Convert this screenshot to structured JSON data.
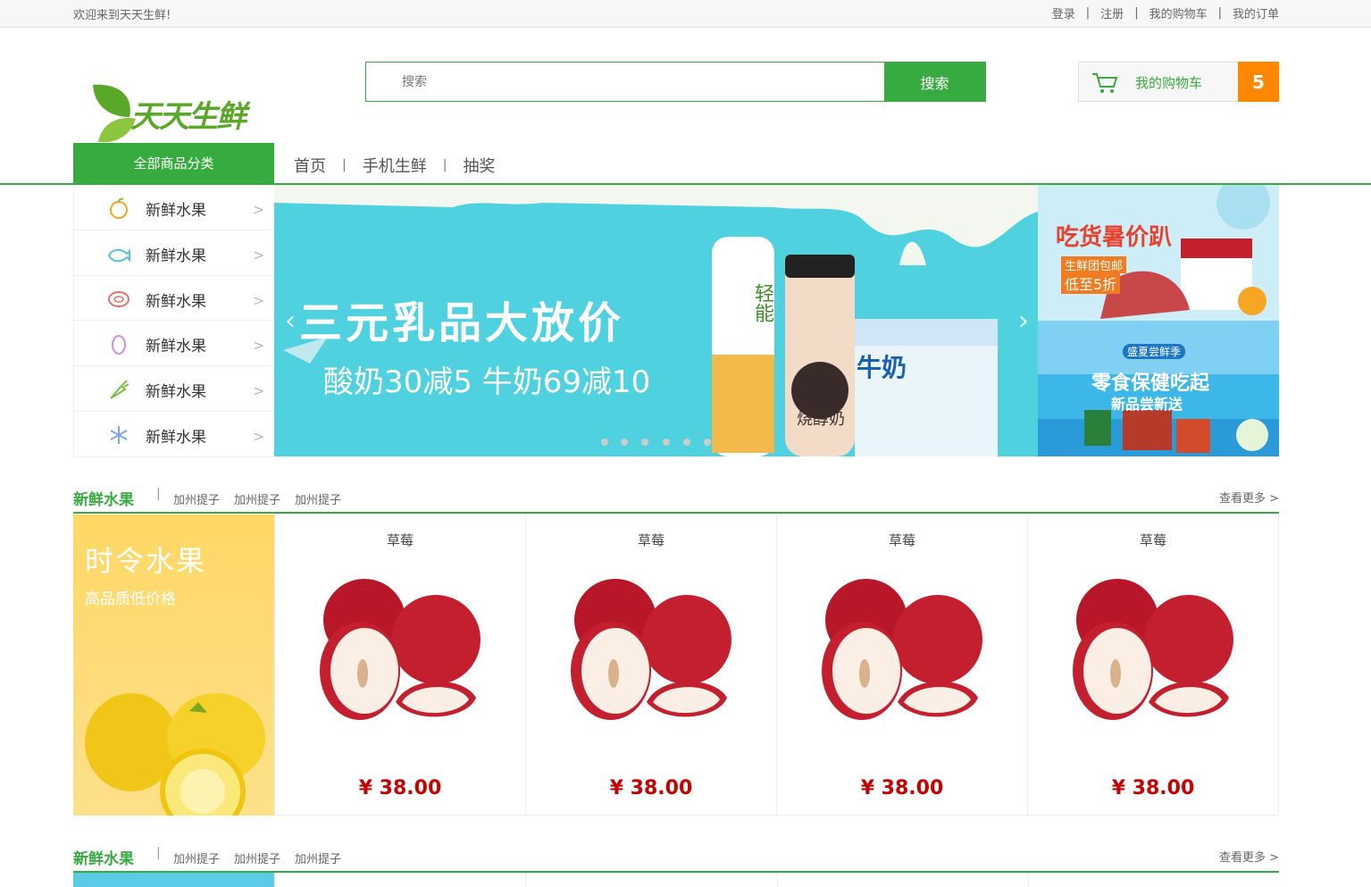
{
  "topbar": {
    "welcome": "欢迎来到天天生鲜!",
    "links": [
      "登录",
      "注册",
      "我的购物车",
      "我的订单"
    ]
  },
  "header": {
    "logo_text": "天天生鲜",
    "search_placeholder": "搜索",
    "search_button": "搜索",
    "cart_label": "我的购物车",
    "cart_count": "5"
  },
  "nav": {
    "all_categories": "全部商品分类",
    "links": [
      "首页",
      "手机生鲜",
      "抽奖"
    ]
  },
  "categories": [
    {
      "label": "新鲜水果",
      "icon": "orange-icon"
    },
    {
      "label": "新鲜水果",
      "icon": "seafood-icon"
    },
    {
      "label": "新鲜水果",
      "icon": "meat-icon"
    },
    {
      "label": "新鲜水果",
      "icon": "egg-icon"
    },
    {
      "label": "新鲜水果",
      "icon": "carrot-icon"
    },
    {
      "label": "新鲜水果",
      "icon": "snowflake-icon"
    }
  ],
  "banner": {
    "headline": "三元乳品大放价",
    "subline": "酸奶30减5 牛奶69减10",
    "product_label_1": "轻能",
    "product_label_2": "烧醇奶",
    "product_label_3": "牛奶",
    "slides": 6
  },
  "ads": {
    "ad1_title": "吃货暑价趴",
    "ad1_sub1": "生鲜团包邮",
    "ad1_sub2": "低至5折",
    "ad2_top": "盛夏尝鲜季",
    "ad2_title": "零食保健吃起",
    "ad2_sub": "新品尝新送"
  },
  "sections": [
    {
      "title": "新鲜水果",
      "tags": [
        "加州提子",
        "加州提子",
        "加州提子"
      ],
      "more": "查看更多 >",
      "promo_title": "时令水果",
      "promo_sub": "高品质低价格",
      "products": [
        {
          "name": "草莓",
          "price": "¥ 38.00"
        },
        {
          "name": "草莓",
          "price": "¥ 38.00"
        },
        {
          "name": "草莓",
          "price": "¥ 38.00"
        },
        {
          "name": "草莓",
          "price": "¥ 38.00"
        }
      ]
    },
    {
      "title": "新鲜水果",
      "tags": [
        "加州提子",
        "加州提子",
        "加州提子"
      ],
      "more": "查看更多 >"
    }
  ],
  "colors": {
    "brand_green": "#37ab40",
    "cart_orange": "#ff8800",
    "price_red": "#c40000"
  }
}
